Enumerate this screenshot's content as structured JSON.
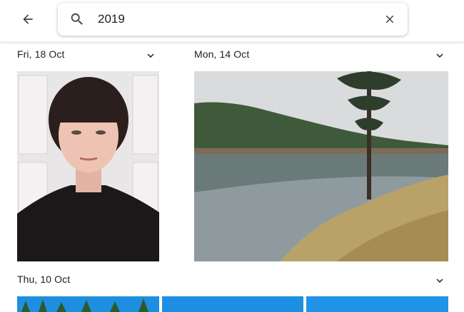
{
  "search": {
    "query": "2019"
  },
  "groups": [
    {
      "date": "Fri, 18 Oct"
    },
    {
      "date": "Mon, 14 Oct"
    },
    {
      "date": "Thu, 10 Oct"
    }
  ],
  "icons": {
    "back": "arrow-back-icon",
    "search": "search-icon",
    "clear": "close-icon",
    "expand": "chevron-down-icon"
  },
  "colors": {
    "text": "#202124",
    "icon": "#5f6368",
    "sky_blue": "#1e8fe0"
  }
}
